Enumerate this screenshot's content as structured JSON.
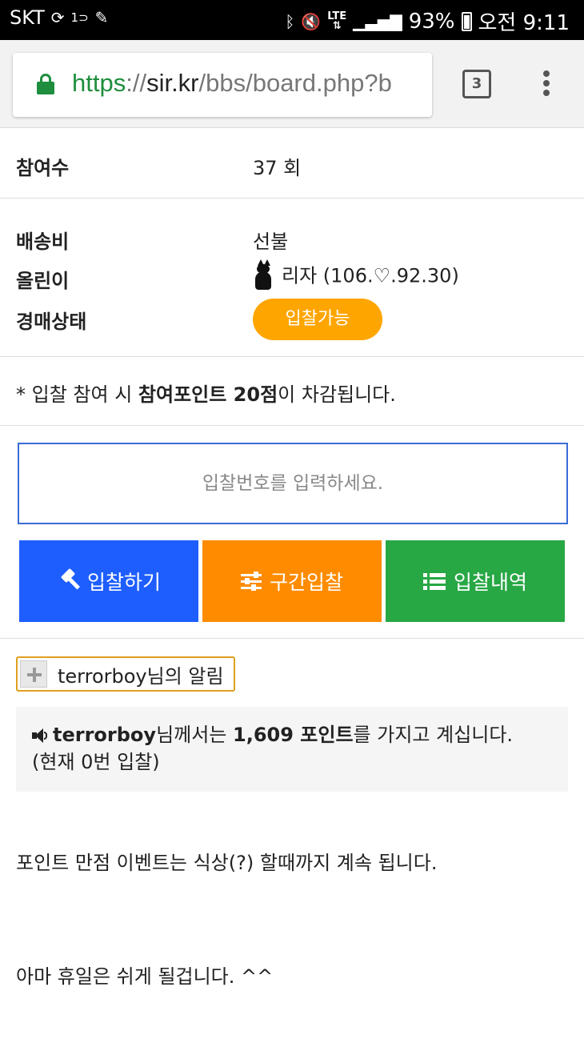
{
  "statusbar": {
    "carrier": "SKT",
    "network_tag": "1⊃",
    "battery": "93%",
    "time": "오전 9:11",
    "lte": "LTE"
  },
  "browser": {
    "url_scheme": "https",
    "url_sep": "://",
    "url_host": "sir.kr",
    "url_path": "/bbs/board.php?b",
    "tab_count": "3"
  },
  "auction": {
    "participants_label": "참여수",
    "participants_value": "37 회",
    "shipping_label": "배송비",
    "shipping_value": "선불",
    "uploader_label": "올린이",
    "uploader_value": "리자 (106.♡.92.30)",
    "status_label": "경매상태",
    "status_value": "입찰가능"
  },
  "notice": {
    "prefix": "* 입찰 참여 시 ",
    "bold": "참여포인트 20점",
    "suffix": "이 차감됩니다."
  },
  "bid": {
    "placeholder": "입찰번호를 입력하세요.",
    "bid_button": "입찰하기",
    "range_button": "구간입찰",
    "history_button": "입찰내역"
  },
  "alert": {
    "toggle_label": "terrorboy님의 알림",
    "user": "terrorboy",
    "text_1": "님께서는 ",
    "points": "1,609 포인트",
    "text_2": "를 가지고 계십니다.",
    "bids": "(현재 0번 입찰)"
  },
  "body": {
    "line1": "포인트 만점 이벤트는 식상(?) 할때까지 계속 됩니다.",
    "line2": "아마 휴일은 쉬게 될겁니다. ^^"
  },
  "colors": {
    "bid": "#1e5eff",
    "range": "#ff8c00",
    "history": "#28a745",
    "status": "#ffa500"
  }
}
